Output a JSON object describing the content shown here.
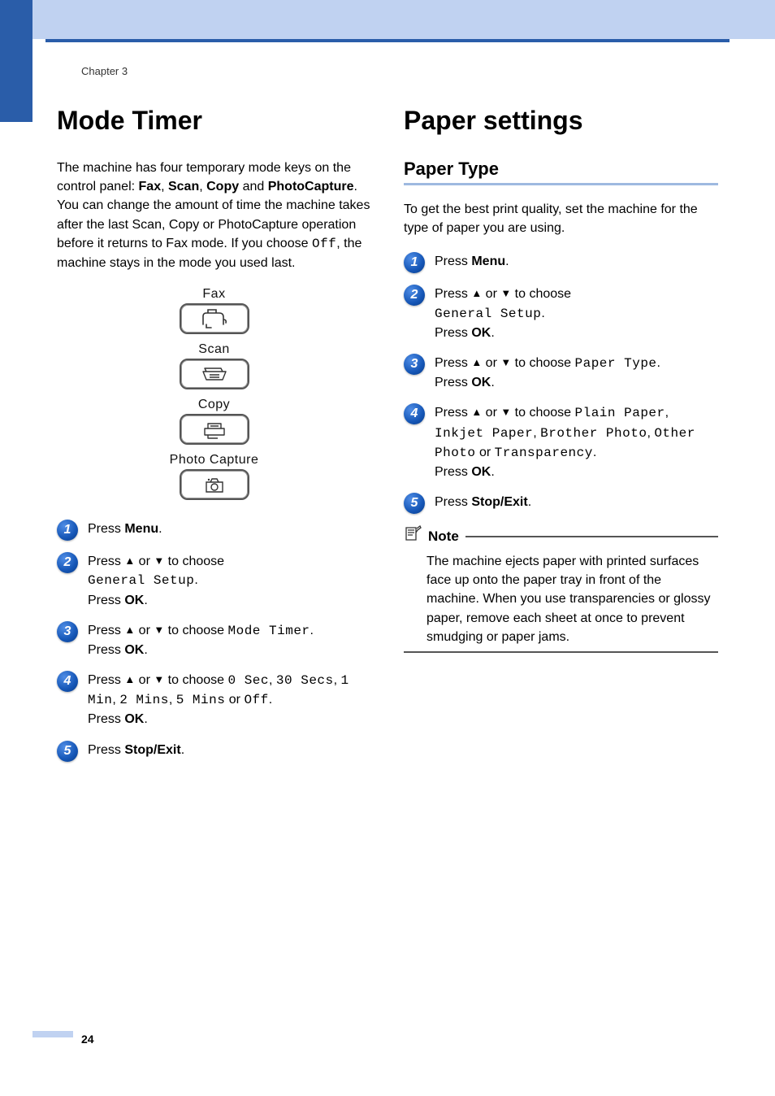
{
  "chapter": "Chapter 3",
  "page_number": "24",
  "left": {
    "h1": "Mode Timer",
    "intro_parts": {
      "p1a": "The machine has four temporary mode keys on the control panel: ",
      "b1": "Fax",
      "comma1": ", ",
      "b2": "Scan",
      "comma2": ", ",
      "b3": "Copy",
      "and": " and ",
      "b4": "PhotoCapture",
      "p1b": ". You can change the amount of time the machine takes after the last Scan, Copy or PhotoCapture operation before it returns to Fax mode. If you choose ",
      "mono_off": "Off",
      "p1c": ", the machine stays in the mode you used last."
    },
    "panel": {
      "fax": "Fax",
      "scan": "Scan",
      "copy": "Copy",
      "photo": "Photo Capture"
    },
    "steps": {
      "1": {
        "pre": "Press ",
        "b": "Menu",
        "post": "."
      },
      "2": {
        "pre": "Press ",
        "mid": " or ",
        "post": " to choose ",
        "mono": "General Setup",
        "dot": ".",
        "press": "Press ",
        "ok": "OK",
        "dot2": "."
      },
      "3": {
        "pre": "Press ",
        "mid": " or ",
        "post": " to choose ",
        "mono": "Mode Timer",
        "dot": ".",
        "press": "Press ",
        "ok": "OK",
        "dot2": "."
      },
      "4": {
        "pre": "Press ",
        "mid": " or ",
        "post": " to choose ",
        "m1": "0 Sec",
        "c1": ", ",
        "m2": "30 Secs",
        "c2": ", ",
        "m3": "1 Min",
        "c3": ", ",
        "m4": "2 Mins",
        "c4": ", ",
        "m5": "5 Mins",
        "or": " or ",
        "m6": "Off",
        "dot": ".",
        "press": "Press ",
        "ok": "OK",
        "dot2": "."
      },
      "5": {
        "pre": "Press ",
        "b": "Stop/Exit",
        "post": "."
      }
    }
  },
  "right": {
    "h1": "Paper settings",
    "h2": "Paper Type",
    "intro": "To get the best print quality, set the machine for the type of paper you are using.",
    "steps": {
      "1": {
        "pre": "Press ",
        "b": "Menu",
        "post": "."
      },
      "2": {
        "pre": "Press ",
        "mid": " or ",
        "post": " to choose ",
        "mono": "General Setup",
        "dot": ".",
        "press": "Press ",
        "ok": "OK",
        "dot2": "."
      },
      "3": {
        "pre": "Press ",
        "mid": " or ",
        "post": " to choose ",
        "mono": "Paper Type",
        "dot": ".",
        "press": "Press ",
        "ok": "OK",
        "dot2": "."
      },
      "4": {
        "pre": "Press ",
        "mid": " or ",
        "post": " to choose ",
        "m1": "Plain Paper",
        "c1": ", ",
        "m2": "Inkjet Paper",
        "c2": ", ",
        "m3": "Brother Photo",
        "c3": ", ",
        "m4": "Other Photo",
        "or": " or ",
        "m5": "Transparency",
        "dot": ".",
        "press": "Press ",
        "ok": "OK",
        "dot2": "."
      },
      "5": {
        "pre": "Press ",
        "b": "Stop/Exit",
        "post": "."
      }
    },
    "note_title": "Note",
    "note_body": "The machine ejects paper with printed surfaces face up onto the paper tray in front of the machine. When you use transparencies or glossy paper, remove each sheet at once to prevent smudging or paper jams."
  }
}
